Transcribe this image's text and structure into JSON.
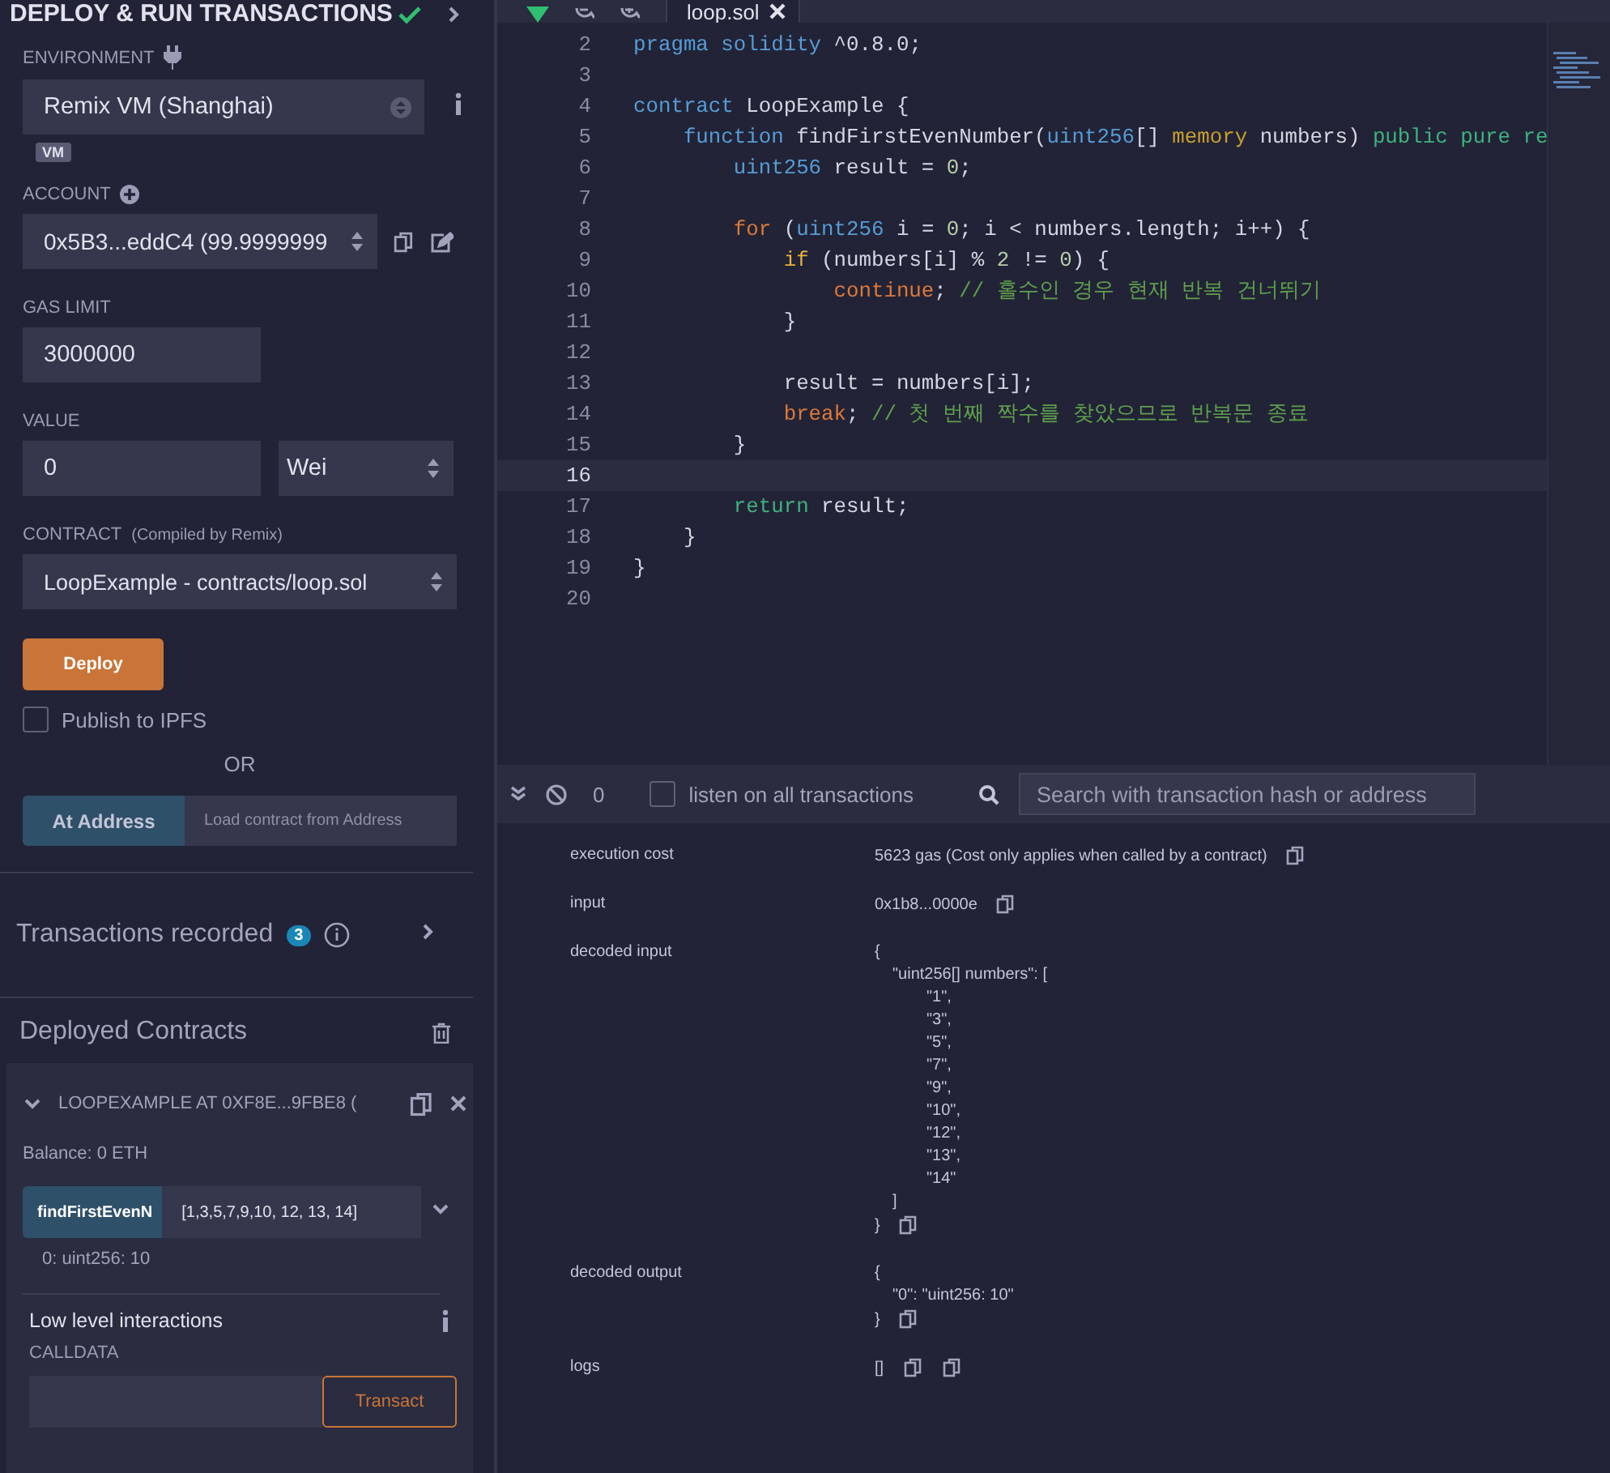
{
  "panel": {
    "title": "DEPLOY & RUN TRANSACTIONS",
    "environment": {
      "label": "ENVIRONMENT",
      "value": "Remix VM (Shanghai)",
      "badge": "VM"
    },
    "account": {
      "label": "ACCOUNT",
      "value": "0x5B3...eddC4 (99.9999999"
    },
    "gas_limit": {
      "label": "GAS LIMIT",
      "value": "3000000"
    },
    "value": {
      "label": "VALUE",
      "amount": "0",
      "unit": "Wei"
    },
    "contract": {
      "label": "CONTRACT",
      "note": "(Compiled by Remix)",
      "value": "LoopExample - contracts/loop.sol"
    },
    "deploy_button": "Deploy",
    "publish": {
      "label": "Publish to IPFS",
      "checked": false
    },
    "or": "OR",
    "at_address": {
      "button": "At Address",
      "placeholder": "Load contract from Address"
    },
    "transactions": {
      "label": "Transactions recorded",
      "count": "3"
    },
    "deployed": {
      "title": "Deployed Contracts",
      "instances": [
        {
          "name": "LOOPEXAMPLE AT 0XF8E...9FBE8 (",
          "expanded": true,
          "balance": "Balance: 0 ETH",
          "functions": [
            {
              "name": "findFirstEvenN",
              "args": "[1,3,5,7,9,10, 12, 13, 14]",
              "result": "0: uint256: 10"
            }
          ],
          "low_level": {
            "title": "Low level interactions",
            "calldata_label": "CALLDATA",
            "button": "Transact"
          }
        }
      ]
    }
  },
  "editor": {
    "tabs": [
      {
        "label": "loop.sol",
        "selected": true
      }
    ],
    "lines": [
      {
        "number": "2",
        "current": false,
        "tokens": [
          {
            "kind": "keyword",
            "text": "pragma solidity"
          },
          {
            "kind": "plain",
            "text": " ^0.8.0;"
          }
        ]
      },
      {
        "number": "3",
        "current": false
      },
      {
        "number": "4",
        "current": false,
        "tokens": [
          {
            "kind": "keyword",
            "text": "contract"
          },
          {
            "kind": "plain",
            "text": " LoopExample {"
          }
        ]
      },
      {
        "number": "5",
        "current": false,
        "tokens": [
          {
            "kind": "keyword",
            "text": "    function"
          },
          {
            "kind": "plain",
            "text": " findFirstEvenNumber("
          },
          {
            "kind": "keyword",
            "text": "uint256"
          },
          {
            "kind": "plain",
            "text": "[] "
          },
          {
            "kind": "storage",
            "text": "memory"
          },
          {
            "kind": "plain",
            "text": " numbers) "
          },
          {
            "kind": "modifier",
            "text": "public pure re"
          }
        ]
      },
      {
        "number": "6",
        "current": false,
        "tokens": [
          {
            "kind": "keyword",
            "text": "        uint256"
          },
          {
            "kind": "plain",
            "text": " result = "
          },
          {
            "kind": "number",
            "text": "0"
          },
          {
            "kind": "plain",
            "text": ";"
          }
        ]
      },
      {
        "number": "7",
        "current": false
      },
      {
        "number": "8",
        "current": false,
        "tokens": [
          {
            "kind": "control",
            "text": "        for"
          },
          {
            "kind": "plain",
            "text": " ("
          },
          {
            "kind": "keyword",
            "text": "uint256"
          },
          {
            "kind": "plain",
            "text": " i = "
          },
          {
            "kind": "number",
            "text": "0"
          },
          {
            "kind": "plain",
            "text": "; i < numbers.length; i++) {"
          }
        ]
      },
      {
        "number": "9",
        "current": false,
        "tokens": [
          {
            "kind": "branch",
            "text": "            if"
          },
          {
            "kind": "plain",
            "text": " (numbers[i] % "
          },
          {
            "kind": "number",
            "text": "2"
          },
          {
            "kind": "plain",
            "text": " != "
          },
          {
            "kind": "number",
            "text": "0"
          },
          {
            "kind": "plain",
            "text": ") {"
          }
        ]
      },
      {
        "number": "10",
        "current": false,
        "tokens": [
          {
            "kind": "control",
            "text": "                continue"
          },
          {
            "kind": "plain",
            "text": "; "
          },
          {
            "kind": "comment",
            "text": "// 홀수인 경우 현재 반복 건너뛰기"
          }
        ]
      },
      {
        "number": "11",
        "current": false,
        "tokens": [
          {
            "kind": "plain",
            "text": "            }"
          }
        ]
      },
      {
        "number": "12",
        "current": false
      },
      {
        "number": "13",
        "current": false,
        "tokens": [
          {
            "kind": "plain",
            "text": "            result = numbers[i];"
          }
        ]
      },
      {
        "number": "14",
        "current": false,
        "tokens": [
          {
            "kind": "control",
            "text": "            break"
          },
          {
            "kind": "plain",
            "text": "; "
          },
          {
            "kind": "comment",
            "text": "// 첫 번째 짝수를 찾았으므로 반복문 종료"
          }
        ]
      },
      {
        "number": "15",
        "current": false,
        "tokens": [
          {
            "kind": "plain",
            "text": "        }"
          }
        ]
      },
      {
        "number": "16",
        "current": true
      },
      {
        "number": "17",
        "current": false,
        "tokens": [
          {
            "kind": "modifier",
            "text": "        return"
          },
          {
            "kind": "plain",
            "text": " result;"
          }
        ]
      },
      {
        "number": "18",
        "current": false,
        "tokens": [
          {
            "kind": "plain",
            "text": "    }"
          }
        ]
      },
      {
        "number": "19",
        "current": false,
        "tokens": [
          {
            "kind": "plain",
            "text": "}"
          }
        ]
      },
      {
        "number": "20",
        "current": false
      }
    ]
  },
  "terminal": {
    "count": "0",
    "listen": {
      "label": "listen on all transactions",
      "checked": false
    },
    "search": {
      "placeholder": "Search with transaction hash or address"
    },
    "rows": [
      {
        "kind": "text",
        "label": "execution cost",
        "value": "5623 gas (Cost only applies when called by a contract)"
      },
      {
        "kind": "text",
        "label": "input",
        "value": "0x1b8...0000e"
      },
      {
        "kind": "object",
        "label": "decoded input",
        "open": "{",
        "entries": [
          {
            "head": "\"uint256[] numbers\": [",
            "items": [
              "\"1\",",
              "\"3\",",
              "\"5\",",
              "\"7\",",
              "\"9\",",
              "\"10\",",
              "\"12\",",
              "\"13\",",
              "\"14\""
            ],
            "tail": "]"
          }
        ],
        "close": "}"
      },
      {
        "kind": "object",
        "label": "decoded output",
        "open": "{",
        "entries": [
          {
            "head": "\"0\": \"uint256: 10\""
          }
        ],
        "close": "}"
      },
      {
        "kind": "list",
        "label": "logs",
        "value": "[]"
      }
    ]
  }
}
